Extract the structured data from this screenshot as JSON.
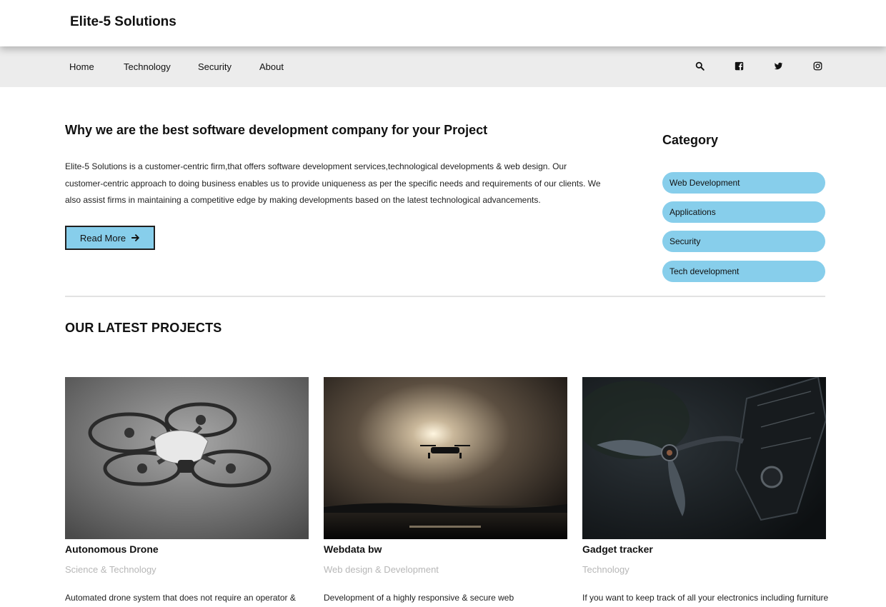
{
  "header": {
    "brand": "Elite-5 Solutions"
  },
  "nav": {
    "items": [
      "Home",
      "Technology",
      "Security",
      "About"
    ],
    "icons": [
      "search-icon",
      "facebook-icon",
      "twitter-icon",
      "instagram-icon"
    ]
  },
  "hero": {
    "title": "Why we are the best software development company for your Project",
    "text": "Elite-5 Solutions is a customer-centric firm,that offers software development services,technological developments & web design. Our customer-centric approach to doing business enables us to provide uniqueness as per the specific needs and requirements of our clients. We also assist firms in maintaining a competitive edge by making developments based on the latest technological advancements.",
    "read_more": "Read More"
  },
  "category": {
    "title": "Category",
    "items": [
      "Web Development",
      "Applications",
      "Security",
      "Tech development"
    ]
  },
  "projects": {
    "title": "OUR LATEST PROJECTS",
    "cards": [
      {
        "title": "Autonomous Drone",
        "subtitle": "Science & Technology",
        "desc": "Automated drone system that does not require an operator &"
      },
      {
        "title": "Webdata bw",
        "subtitle": "Web design & Development",
        "desc": "Development of a highly responsive & secure web"
      },
      {
        "title": "Gadget tracker",
        "subtitle": "Technology",
        "desc": "If you want to keep track of all your electronics including furniture"
      }
    ]
  },
  "colors": {
    "accent": "#87ceeb",
    "nav_bg": "#ececec",
    "muted": "#b7b7b7"
  }
}
